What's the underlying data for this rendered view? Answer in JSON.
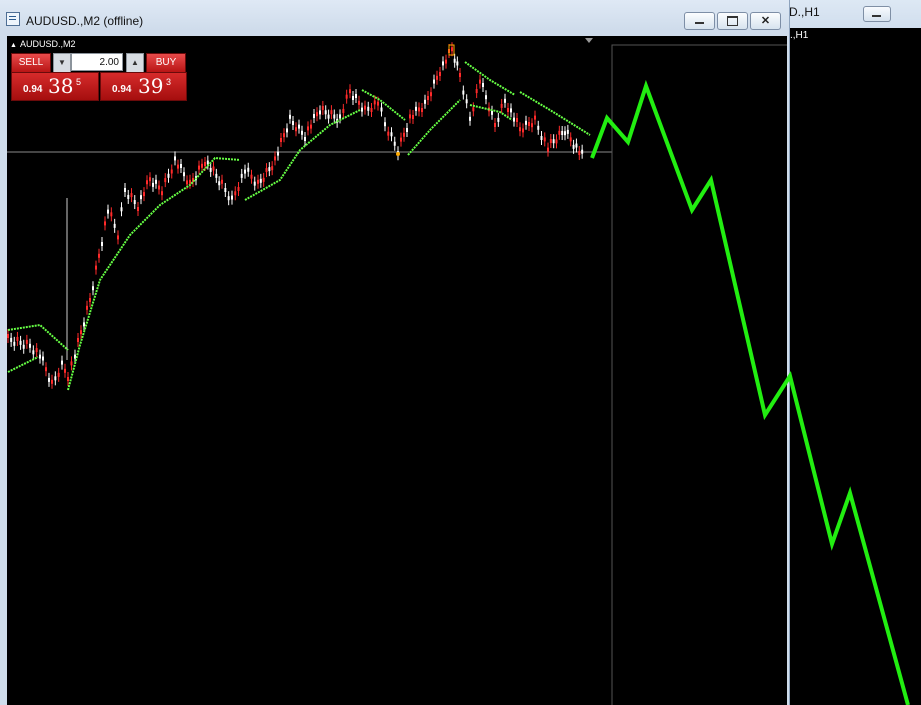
{
  "background_window": {
    "title": "D.,H1",
    "chart_label": ".,H1"
  },
  "window": {
    "title": "AUDUSD.,M2 (offline)",
    "close_glyph": "✕"
  },
  "trade_panel": {
    "symbol": "AUDUSD.,M2",
    "sell_label": "SELL",
    "buy_label": "BUY",
    "lot_size": "2.00",
    "bid": {
      "prefix": "0.94",
      "big": "38",
      "sup": "5"
    },
    "ask": {
      "prefix": "0.94",
      "big": "39",
      "sup": "3"
    }
  },
  "icons": {
    "collapse": "▲",
    "spin_down": "▼",
    "spin_up": "▲"
  },
  "colors": {
    "bull_candle": "#ff2a2a",
    "bear_candle": "#ffffff",
    "indicator": "#66ff44",
    "projection": "#22ee11",
    "grid_line": "#8a8a8a"
  }
}
